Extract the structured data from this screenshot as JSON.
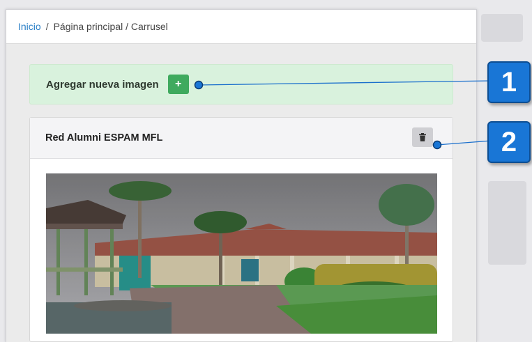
{
  "breadcrumb": {
    "home": "Inicio",
    "separator": "/",
    "path": "Página principal / Carrusel"
  },
  "add_section": {
    "label": "Agregar nueva imagen",
    "button_icon": "+"
  },
  "slides": [
    {
      "title": "Red Alumni ESPAM MFL",
      "delete_icon": "trash-icon",
      "image_subject": "campus-photo"
    }
  ],
  "callouts": [
    "1",
    "2"
  ],
  "colors": {
    "link": "#2a7fc7",
    "add_bg": "#d9f2dd",
    "add_button": "#3faa5e",
    "callout": "#1976d6"
  }
}
